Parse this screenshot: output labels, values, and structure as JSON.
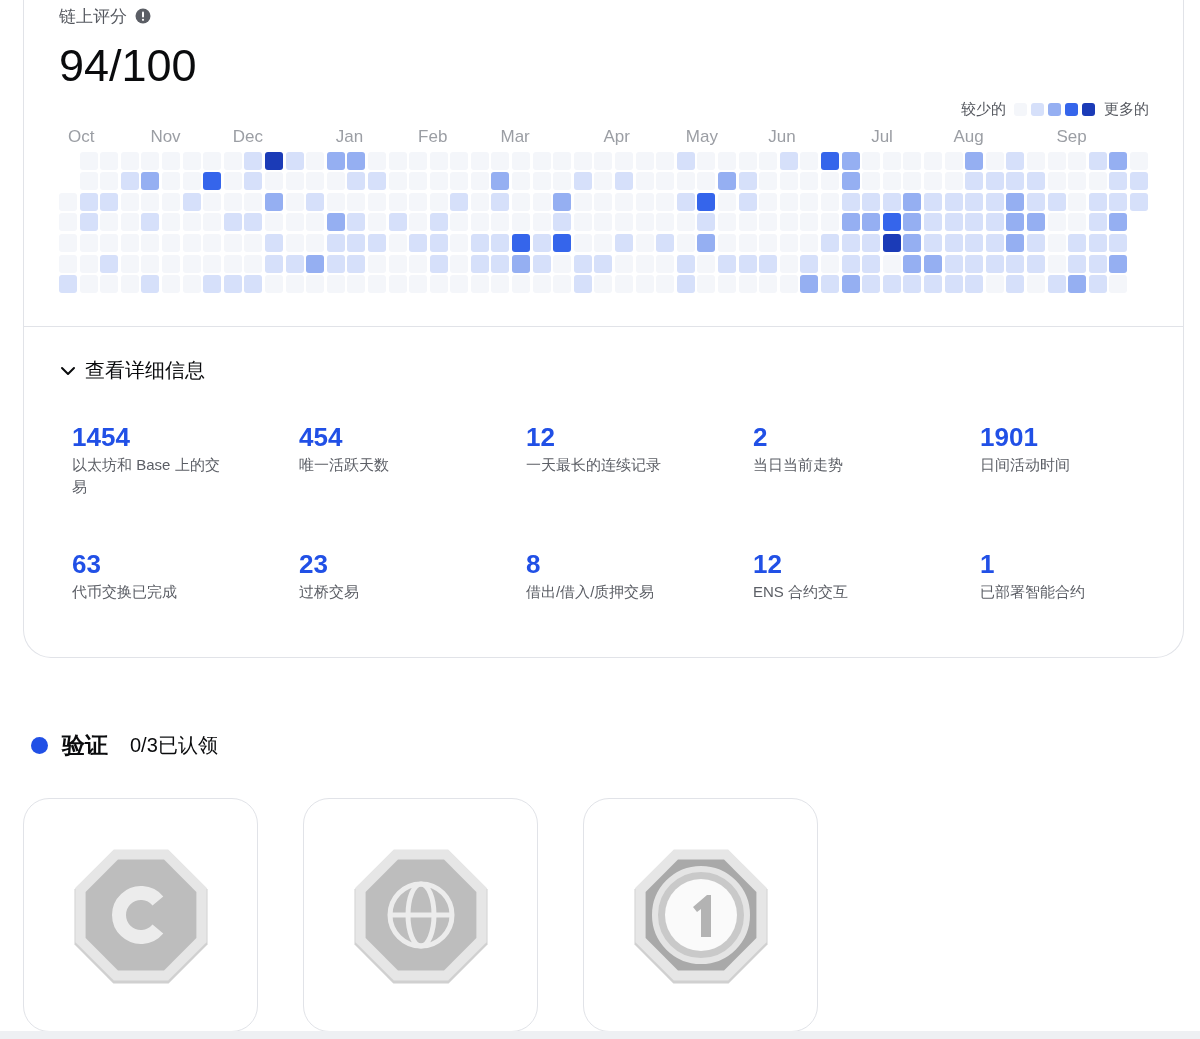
{
  "score": {
    "title": "链上评分",
    "value": "94/100"
  },
  "legend": {
    "less": "较少的",
    "swatches": [
      {
        "color": "#f4f6fa"
      },
      {
        "color": "#d6e0fa"
      },
      {
        "color": "#95aff2"
      },
      {
        "color": "#3565eb"
      },
      {
        "color": "#1b3bb7"
      }
    ],
    "more": "更多的"
  },
  "heatmap": {
    "weeks": [
      {
        "month": "Oct",
        "days": [
          {
            "color": "#f4f6fa"
          },
          {
            "color": "#f4f6fa"
          },
          {
            "color": "#f4f6fa"
          },
          {
            "color": "#f4f6fa"
          },
          {
            "color": "#d6e0fa"
          }
        ]
      },
      {
        "days": [
          {
            "color": "#f4f6fa"
          },
          {
            "color": "#f4f6fa"
          },
          {
            "color": "#d6e0fa"
          },
          {
            "color": "#d6e0fa"
          },
          {
            "color": "#f4f6fa"
          },
          {
            "color": "#f4f6fa"
          },
          {
            "color": "#f4f6fa"
          }
        ]
      },
      {
        "days": [
          {
            "color": "#f4f6fa"
          },
          {
            "color": "#f4f6fa"
          },
          {
            "color": "#d6e0fa"
          },
          {
            "color": "#f4f6fa"
          },
          {
            "color": "#f4f6fa"
          },
          {
            "color": "#d6e0fa"
          },
          {
            "color": "#f4f6fa"
          }
        ]
      },
      {
        "days": [
          {
            "color": "#f4f6fa"
          },
          {
            "color": "#d6e0fa"
          },
          {
            "color": "#f4f6fa"
          },
          {
            "color": "#f4f6fa"
          },
          {
            "color": "#f4f6fa"
          },
          {
            "color": "#f4f6fa"
          },
          {
            "color": "#f4f6fa"
          }
        ]
      },
      {
        "month": "Nov",
        "days": [
          {
            "color": "#f4f6fa"
          },
          {
            "color": "#95aff2"
          },
          {
            "color": "#f4f6fa"
          },
          {
            "color": "#d6e0fa"
          },
          {
            "color": "#f4f6fa"
          },
          {
            "color": "#f4f6fa"
          },
          {
            "color": "#d6e0fa"
          }
        ]
      },
      {
        "days": [
          {
            "color": "#f4f6fa"
          },
          {
            "color": "#f4f6fa"
          },
          {
            "color": "#f4f6fa"
          },
          {
            "color": "#f4f6fa"
          },
          {
            "color": "#f4f6fa"
          },
          {
            "color": "#f4f6fa"
          },
          {
            "color": "#f4f6fa"
          }
        ]
      },
      {
        "days": [
          {
            "color": "#f4f6fa"
          },
          {
            "color": "#f4f6fa"
          },
          {
            "color": "#d6e0fa"
          },
          {
            "color": "#f4f6fa"
          },
          {
            "color": "#f4f6fa"
          },
          {
            "color": "#f4f6fa"
          },
          {
            "color": "#f4f6fa"
          }
        ]
      },
      {
        "days": [
          {
            "color": "#f4f6fa"
          },
          {
            "color": "#3565eb"
          },
          {
            "color": "#f4f6fa"
          },
          {
            "color": "#f4f6fa"
          },
          {
            "color": "#f4f6fa"
          },
          {
            "color": "#f4f6fa"
          },
          {
            "color": "#d6e0fa"
          }
        ]
      },
      {
        "month": "Dec",
        "days": [
          {
            "color": "#f4f6fa"
          },
          {
            "color": "#f4f6fa"
          },
          {
            "color": "#f4f6fa"
          },
          {
            "color": "#d6e0fa"
          },
          {
            "color": "#f4f6fa"
          },
          {
            "color": "#f4f6fa"
          },
          {
            "color": "#d6e0fa"
          }
        ]
      },
      {
        "days": [
          {
            "color": "#d6e0fa"
          },
          {
            "color": "#d6e0fa"
          },
          {
            "color": "#f4f6fa"
          },
          {
            "color": "#d6e0fa"
          },
          {
            "color": "#f4f6fa"
          },
          {
            "color": "#f4f6fa"
          },
          {
            "color": "#d6e0fa"
          }
        ]
      },
      {
        "days": [
          {
            "color": "#1b3bb7"
          },
          {
            "color": "#f4f6fa"
          },
          {
            "color": "#95aff2"
          },
          {
            "color": "#f4f6fa"
          },
          {
            "color": "#d6e0fa"
          },
          {
            "color": "#d6e0fa"
          },
          {
            "color": "#f4f6fa"
          }
        ]
      },
      {
        "days": [
          {
            "color": "#d6e0fa"
          },
          {
            "color": "#f4f6fa"
          },
          {
            "color": "#f4f6fa"
          },
          {
            "color": "#f4f6fa"
          },
          {
            "color": "#f4f6fa"
          },
          {
            "color": "#d6e0fa"
          },
          {
            "color": "#f4f6fa"
          }
        ]
      },
      {
        "days": [
          {
            "color": "#f4f6fa"
          },
          {
            "color": "#f4f6fa"
          },
          {
            "color": "#d6e0fa"
          },
          {
            "color": "#f4f6fa"
          },
          {
            "color": "#f4f6fa"
          },
          {
            "color": "#95aff2"
          },
          {
            "color": "#f4f6fa"
          }
        ]
      },
      {
        "month": "Jan",
        "days": [
          {
            "color": "#95aff2"
          },
          {
            "color": "#f4f6fa"
          },
          {
            "color": "#f4f6fa"
          },
          {
            "color": "#95aff2"
          },
          {
            "color": "#d6e0fa"
          },
          {
            "color": "#d6e0fa"
          },
          {
            "color": "#f4f6fa"
          }
        ]
      },
      {
        "days": [
          {
            "color": "#95aff2"
          },
          {
            "color": "#d6e0fa"
          },
          {
            "color": "#f4f6fa"
          },
          {
            "color": "#d6e0fa"
          },
          {
            "color": "#d6e0fa"
          },
          {
            "color": "#d6e0fa"
          },
          {
            "color": "#f4f6fa"
          }
        ]
      },
      {
        "days": [
          {
            "color": "#f4f6fa"
          },
          {
            "color": "#d6e0fa"
          },
          {
            "color": "#f4f6fa"
          },
          {
            "color": "#f4f6fa"
          },
          {
            "color": "#d6e0fa"
          },
          {
            "color": "#f4f6fa"
          },
          {
            "color": "#f4f6fa"
          }
        ]
      },
      {
        "days": [
          {
            "color": "#f4f6fa"
          },
          {
            "color": "#f4f6fa"
          },
          {
            "color": "#f4f6fa"
          },
          {
            "color": "#d6e0fa"
          },
          {
            "color": "#f4f6fa"
          },
          {
            "color": "#f4f6fa"
          },
          {
            "color": "#f4f6fa"
          }
        ]
      },
      {
        "month": "Feb",
        "days": [
          {
            "color": "#f4f6fa"
          },
          {
            "color": "#f4f6fa"
          },
          {
            "color": "#f4f6fa"
          },
          {
            "color": "#f4f6fa"
          },
          {
            "color": "#d6e0fa"
          },
          {
            "color": "#f4f6fa"
          },
          {
            "color": "#f4f6fa"
          }
        ]
      },
      {
        "days": [
          {
            "color": "#f4f6fa"
          },
          {
            "color": "#f4f6fa"
          },
          {
            "color": "#f4f6fa"
          },
          {
            "color": "#d6e0fa"
          },
          {
            "color": "#d6e0fa"
          },
          {
            "color": "#d6e0fa"
          },
          {
            "color": "#f4f6fa"
          }
        ]
      },
      {
        "days": [
          {
            "color": "#f4f6fa"
          },
          {
            "color": "#f4f6fa"
          },
          {
            "color": "#d6e0fa"
          },
          {
            "color": "#f4f6fa"
          },
          {
            "color": "#f4f6fa"
          },
          {
            "color": "#f4f6fa"
          },
          {
            "color": "#f4f6fa"
          }
        ]
      },
      {
        "days": [
          {
            "color": "#f4f6fa"
          },
          {
            "color": "#f4f6fa"
          },
          {
            "color": "#f4f6fa"
          },
          {
            "color": "#f4f6fa"
          },
          {
            "color": "#d6e0fa"
          },
          {
            "color": "#d6e0fa"
          },
          {
            "color": "#f4f6fa"
          }
        ]
      },
      {
        "month": "Mar",
        "days": [
          {
            "color": "#f4f6fa"
          },
          {
            "color": "#95aff2"
          },
          {
            "color": "#d6e0fa"
          },
          {
            "color": "#f4f6fa"
          },
          {
            "color": "#d6e0fa"
          },
          {
            "color": "#d6e0fa"
          },
          {
            "color": "#f4f6fa"
          }
        ]
      },
      {
        "days": [
          {
            "color": "#f4f6fa"
          },
          {
            "color": "#f4f6fa"
          },
          {
            "color": "#f4f6fa"
          },
          {
            "color": "#f4f6fa"
          },
          {
            "color": "#3565eb"
          },
          {
            "color": "#95aff2"
          },
          {
            "color": "#f4f6fa"
          }
        ]
      },
      {
        "days": [
          {
            "color": "#f4f6fa"
          },
          {
            "color": "#f4f6fa"
          },
          {
            "color": "#f4f6fa"
          },
          {
            "color": "#f4f6fa"
          },
          {
            "color": "#d6e0fa"
          },
          {
            "color": "#d6e0fa"
          },
          {
            "color": "#f4f6fa"
          }
        ]
      },
      {
        "days": [
          {
            "color": "#f4f6fa"
          },
          {
            "color": "#f4f6fa"
          },
          {
            "color": "#95aff2"
          },
          {
            "color": "#d6e0fa"
          },
          {
            "color": "#3565eb"
          },
          {
            "color": "#f4f6fa"
          },
          {
            "color": "#f4f6fa"
          }
        ]
      },
      {
        "days": [
          {
            "color": "#f4f6fa"
          },
          {
            "color": "#d6e0fa"
          },
          {
            "color": "#f4f6fa"
          },
          {
            "color": "#f4f6fa"
          },
          {
            "color": "#f4f6fa"
          },
          {
            "color": "#d6e0fa"
          },
          {
            "color": "#d6e0fa"
          }
        ]
      },
      {
        "month": "Apr",
        "days": [
          {
            "color": "#f4f6fa"
          },
          {
            "color": "#f4f6fa"
          },
          {
            "color": "#f4f6fa"
          },
          {
            "color": "#f4f6fa"
          },
          {
            "color": "#f4f6fa"
          },
          {
            "color": "#d6e0fa"
          },
          {
            "color": "#f4f6fa"
          }
        ]
      },
      {
        "days": [
          {
            "color": "#f4f6fa"
          },
          {
            "color": "#d6e0fa"
          },
          {
            "color": "#f4f6fa"
          },
          {
            "color": "#f4f6fa"
          },
          {
            "color": "#d6e0fa"
          },
          {
            "color": "#f4f6fa"
          },
          {
            "color": "#f4f6fa"
          }
        ]
      },
      {
        "days": [
          {
            "color": "#f4f6fa"
          },
          {
            "color": "#f4f6fa"
          },
          {
            "color": "#f4f6fa"
          },
          {
            "color": "#f4f6fa"
          },
          {
            "color": "#f4f6fa"
          },
          {
            "color": "#f4f6fa"
          },
          {
            "color": "#f4f6fa"
          }
        ]
      },
      {
        "days": [
          {
            "color": "#f4f6fa"
          },
          {
            "color": "#f4f6fa"
          },
          {
            "color": "#f4f6fa"
          },
          {
            "color": "#f4f6fa"
          },
          {
            "color": "#d6e0fa"
          },
          {
            "color": "#f4f6fa"
          },
          {
            "color": "#f4f6fa"
          }
        ]
      },
      {
        "month": "May",
        "days": [
          {
            "color": "#d6e0fa"
          },
          {
            "color": "#f4f6fa"
          },
          {
            "color": "#d6e0fa"
          },
          {
            "color": "#f4f6fa"
          },
          {
            "color": "#f4f6fa"
          },
          {
            "color": "#d6e0fa"
          },
          {
            "color": "#d6e0fa"
          }
        ]
      },
      {
        "days": [
          {
            "color": "#f4f6fa"
          },
          {
            "color": "#f4f6fa"
          },
          {
            "color": "#3565eb"
          },
          {
            "color": "#d6e0fa"
          },
          {
            "color": "#95aff2"
          },
          {
            "color": "#f4f6fa"
          },
          {
            "color": "#f4f6fa"
          }
        ]
      },
      {
        "days": [
          {
            "color": "#f4f6fa"
          },
          {
            "color": "#95aff2"
          },
          {
            "color": "#f4f6fa"
          },
          {
            "color": "#f4f6fa"
          },
          {
            "color": "#f4f6fa"
          },
          {
            "color": "#d6e0fa"
          },
          {
            "color": "#f4f6fa"
          }
        ]
      },
      {
        "days": [
          {
            "color": "#f4f6fa"
          },
          {
            "color": "#d6e0fa"
          },
          {
            "color": "#d6e0fa"
          },
          {
            "color": "#f4f6fa"
          },
          {
            "color": "#f4f6fa"
          },
          {
            "color": "#d6e0fa"
          },
          {
            "color": "#f4f6fa"
          }
        ]
      },
      {
        "month": "Jun",
        "days": [
          {
            "color": "#f4f6fa"
          },
          {
            "color": "#f4f6fa"
          },
          {
            "color": "#f4f6fa"
          },
          {
            "color": "#f4f6fa"
          },
          {
            "color": "#f4f6fa"
          },
          {
            "color": "#d6e0fa"
          },
          {
            "color": "#f4f6fa"
          }
        ]
      },
      {
        "days": [
          {
            "color": "#d6e0fa"
          },
          {
            "color": "#f4f6fa"
          },
          {
            "color": "#f4f6fa"
          },
          {
            "color": "#f4f6fa"
          },
          {
            "color": "#f4f6fa"
          },
          {
            "color": "#f4f6fa"
          },
          {
            "color": "#f4f6fa"
          }
        ]
      },
      {
        "days": [
          {
            "color": "#f4f6fa"
          },
          {
            "color": "#f4f6fa"
          },
          {
            "color": "#f4f6fa"
          },
          {
            "color": "#f4f6fa"
          },
          {
            "color": "#f4f6fa"
          },
          {
            "color": "#d6e0fa"
          },
          {
            "color": "#95aff2"
          }
        ]
      },
      {
        "days": [
          {
            "color": "#3565eb"
          },
          {
            "color": "#f4f6fa"
          },
          {
            "color": "#f4f6fa"
          },
          {
            "color": "#f4f6fa"
          },
          {
            "color": "#d6e0fa"
          },
          {
            "color": "#f4f6fa"
          },
          {
            "color": "#d6e0fa"
          }
        ]
      },
      {
        "days": [
          {
            "color": "#95aff2"
          },
          {
            "color": "#95aff2"
          },
          {
            "color": "#d6e0fa"
          },
          {
            "color": "#95aff2"
          },
          {
            "color": "#d6e0fa"
          },
          {
            "color": "#d6e0fa"
          },
          {
            "color": "#95aff2"
          }
        ]
      },
      {
        "month": "Jul",
        "days": [
          {
            "color": "#f4f6fa"
          },
          {
            "color": "#f4f6fa"
          },
          {
            "color": "#d6e0fa"
          },
          {
            "color": "#95aff2"
          },
          {
            "color": "#d6e0fa"
          },
          {
            "color": "#d6e0fa"
          },
          {
            "color": "#d6e0fa"
          }
        ]
      },
      {
        "days": [
          {
            "color": "#f4f6fa"
          },
          {
            "color": "#f4f6fa"
          },
          {
            "color": "#d6e0fa"
          },
          {
            "color": "#3565eb"
          },
          {
            "color": "#1b3bb7"
          },
          {
            "color": "#f4f6fa"
          },
          {
            "color": "#d6e0fa"
          }
        ]
      },
      {
        "days": [
          {
            "color": "#f4f6fa"
          },
          {
            "color": "#f4f6fa"
          },
          {
            "color": "#95aff2"
          },
          {
            "color": "#95aff2"
          },
          {
            "color": "#95aff2"
          },
          {
            "color": "#95aff2"
          },
          {
            "color": "#d6e0fa"
          }
        ]
      },
      {
        "days": [
          {
            "color": "#f4f6fa"
          },
          {
            "color": "#f4f6fa"
          },
          {
            "color": "#d6e0fa"
          },
          {
            "color": "#d6e0fa"
          },
          {
            "color": "#d6e0fa"
          },
          {
            "color": "#95aff2"
          },
          {
            "color": "#d6e0fa"
          }
        ]
      },
      {
        "month": "Aug",
        "days": [
          {
            "color": "#f4f6fa"
          },
          {
            "color": "#f4f6fa"
          },
          {
            "color": "#d6e0fa"
          },
          {
            "color": "#d6e0fa"
          },
          {
            "color": "#d6e0fa"
          },
          {
            "color": "#d6e0fa"
          },
          {
            "color": "#d6e0fa"
          }
        ]
      },
      {
        "days": [
          {
            "color": "#95aff2"
          },
          {
            "color": "#d6e0fa"
          },
          {
            "color": "#d6e0fa"
          },
          {
            "color": "#d6e0fa"
          },
          {
            "color": "#d6e0fa"
          },
          {
            "color": "#d6e0fa"
          },
          {
            "color": "#d6e0fa"
          }
        ]
      },
      {
        "days": [
          {
            "color": "#f4f6fa"
          },
          {
            "color": "#d6e0fa"
          },
          {
            "color": "#d6e0fa"
          },
          {
            "color": "#d6e0fa"
          },
          {
            "color": "#d6e0fa"
          },
          {
            "color": "#d6e0fa"
          },
          {
            "color": "#f4f6fa"
          }
        ]
      },
      {
        "days": [
          {
            "color": "#d6e0fa"
          },
          {
            "color": "#d6e0fa"
          },
          {
            "color": "#95aff2"
          },
          {
            "color": "#95aff2"
          },
          {
            "color": "#95aff2"
          },
          {
            "color": "#d6e0fa"
          },
          {
            "color": "#d6e0fa"
          }
        ]
      },
      {
        "days": [
          {
            "color": "#f4f6fa"
          },
          {
            "color": "#d6e0fa"
          },
          {
            "color": "#d6e0fa"
          },
          {
            "color": "#95aff2"
          },
          {
            "color": "#d6e0fa"
          },
          {
            "color": "#d6e0fa"
          },
          {
            "color": "#f4f6fa"
          }
        ]
      },
      {
        "month": "Sep",
        "days": [
          {
            "color": "#f4f6fa"
          },
          {
            "color": "#f4f6fa"
          },
          {
            "color": "#d6e0fa"
          },
          {
            "color": "#f4f6fa"
          },
          {
            "color": "#f4f6fa"
          },
          {
            "color": "#f4f6fa"
          },
          {
            "color": "#d6e0fa"
          }
        ]
      },
      {
        "days": [
          {
            "color": "#f4f6fa"
          },
          {
            "color": "#f4f6fa"
          },
          {
            "color": "#f4f6fa"
          },
          {
            "color": "#f4f6fa"
          },
          {
            "color": "#d6e0fa"
          },
          {
            "color": "#d6e0fa"
          },
          {
            "color": "#95aff2"
          }
        ]
      },
      {
        "days": [
          {
            "color": "#d6e0fa"
          },
          {
            "color": "#f4f6fa"
          },
          {
            "color": "#d6e0fa"
          },
          {
            "color": "#d6e0fa"
          },
          {
            "color": "#d6e0fa"
          },
          {
            "color": "#d6e0fa"
          },
          {
            "color": "#d6e0fa"
          }
        ]
      },
      {
        "days": [
          {
            "color": "#95aff2"
          },
          {
            "color": "#d6e0fa"
          },
          {
            "color": "#d6e0fa"
          },
          {
            "color": "#95aff2"
          },
          {
            "color": "#d6e0fa"
          },
          {
            "color": "#95aff2"
          },
          {
            "color": "#f4f6fa"
          }
        ]
      },
      {
        "days": [
          {
            "color": "#f4f6fa"
          },
          {
            "color": "#d6e0fa"
          },
          {
            "color": "#d6e0fa"
          }
        ]
      }
    ]
  },
  "details": {
    "label": "查看详细信息",
    "expanded": true,
    "stats": [
      {
        "value": "1454",
        "label": "以太坊和 Base 上的交易"
      },
      {
        "value": "454",
        "label": "唯一活跃天数"
      },
      {
        "value": "12",
        "label": "一天最长的连续记录"
      },
      {
        "value": "2",
        "label": "当日当前走势"
      },
      {
        "value": "1901",
        "label": "日间活动时间"
      },
      {
        "value": "63",
        "label": "代币交换已完成"
      },
      {
        "value": "23",
        "label": "过桥交易"
      },
      {
        "value": "8",
        "label": "借出/借入/质押交易"
      },
      {
        "value": "12",
        "label": "ENS 合约交互"
      },
      {
        "value": "1",
        "label": "已部署智能合约"
      }
    ]
  },
  "verification": {
    "title": "验证",
    "progress": "0/3已认领",
    "badges": [
      {
        "kind": "letter-c"
      },
      {
        "kind": "globe"
      },
      {
        "kind": "numeral-coin"
      }
    ]
  }
}
